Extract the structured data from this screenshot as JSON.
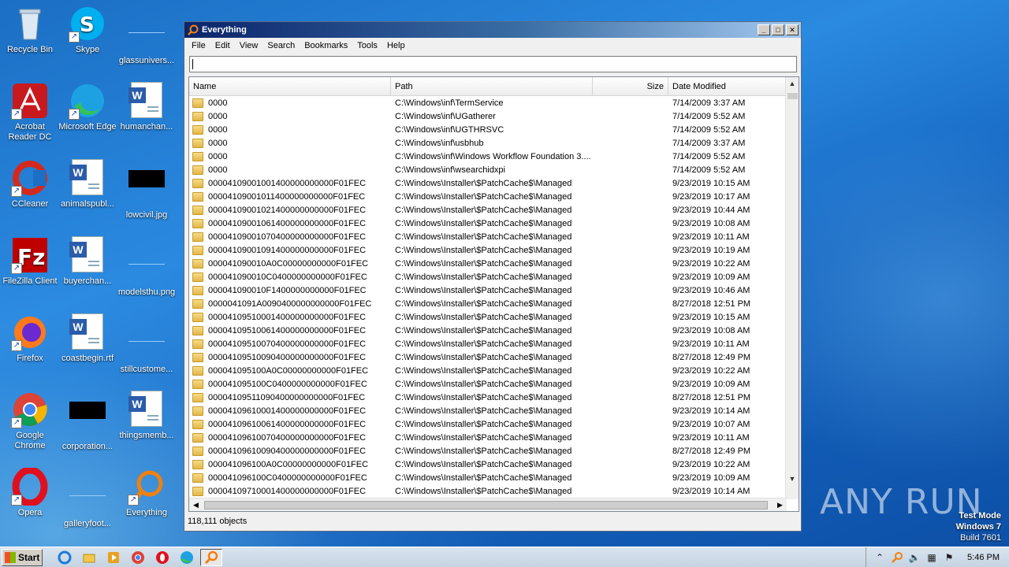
{
  "desktop": {
    "icons": [
      {
        "label": "Recycle Bin"
      },
      {
        "label": "Skype"
      },
      {
        "label": "glassunivers..."
      },
      {
        "label": "Acrobat Reader DC"
      },
      {
        "label": "Microsoft Edge"
      },
      {
        "label": "humanchan..."
      },
      {
        "label": "CCleaner"
      },
      {
        "label": "animalspubl..."
      },
      {
        "label": "lowcivil.jpg"
      },
      {
        "label": "FileZilla Client"
      },
      {
        "label": "buyerchan..."
      },
      {
        "label": "modelsthu.png"
      },
      {
        "label": "Firefox"
      },
      {
        "label": "coastbegin.rtf"
      },
      {
        "label": "stillcustome..."
      },
      {
        "label": "Google Chrome"
      },
      {
        "label": "corporation..."
      },
      {
        "label": "thingsmemb..."
      },
      {
        "label": "Opera"
      },
      {
        "label": "galleryfoot..."
      },
      {
        "label": "Everything"
      }
    ]
  },
  "window": {
    "title": "Everything",
    "controls": {
      "minimize": "_",
      "maximize": "□",
      "close": "✕"
    },
    "menu": [
      "File",
      "Edit",
      "View",
      "Search",
      "Bookmarks",
      "Tools",
      "Help"
    ],
    "search": {
      "value": "",
      "placeholder": ""
    },
    "columns": [
      "Name",
      "Path",
      "Size",
      "Date Modified"
    ],
    "rows": [
      {
        "name": "0000",
        "path": "C:\\Windows\\inf\\TermService",
        "size": "",
        "date": "7/14/2009 3:37 AM"
      },
      {
        "name": "0000",
        "path": "C:\\Windows\\inf\\UGatherer",
        "size": "",
        "date": "7/14/2009 5:52 AM"
      },
      {
        "name": "0000",
        "path": "C:\\Windows\\inf\\UGTHRSVC",
        "size": "",
        "date": "7/14/2009 5:52 AM"
      },
      {
        "name": "0000",
        "path": "C:\\Windows\\inf\\usbhub",
        "size": "",
        "date": "7/14/2009 3:37 AM"
      },
      {
        "name": "0000",
        "path": "C:\\Windows\\inf\\Windows Workflow Foundation 3....",
        "size": "",
        "date": "7/14/2009 5:52 AM"
      },
      {
        "name": "0000",
        "path": "C:\\Windows\\inf\\wsearchidxpi",
        "size": "",
        "date": "7/14/2009 5:52 AM"
      },
      {
        "name": "00004109001001400000000000F01FEC",
        "path": "C:\\Windows\\Installer\\$PatchCache$\\Managed",
        "size": "",
        "date": "9/23/2019 10:15 AM"
      },
      {
        "name": "00004109001011400000000000F01FEC",
        "path": "C:\\Windows\\Installer\\$PatchCache$\\Managed",
        "size": "",
        "date": "9/23/2019 10:17 AM"
      },
      {
        "name": "00004109001021400000000000F01FEC",
        "path": "C:\\Windows\\Installer\\$PatchCache$\\Managed",
        "size": "",
        "date": "9/23/2019 10:44 AM"
      },
      {
        "name": "00004109001061400000000000F01FEC",
        "path": "C:\\Windows\\Installer\\$PatchCache$\\Managed",
        "size": "",
        "date": "9/23/2019 10:08 AM"
      },
      {
        "name": "00004109001070400000000000F01FEC",
        "path": "C:\\Windows\\Installer\\$PatchCache$\\Managed",
        "size": "",
        "date": "9/23/2019 10:11 AM"
      },
      {
        "name": "00004109001091400000000000F01FEC",
        "path": "C:\\Windows\\Installer\\$PatchCache$\\Managed",
        "size": "",
        "date": "9/23/2019 10:19 AM"
      },
      {
        "name": "000041090010A0C00000000000F01FEC",
        "path": "C:\\Windows\\Installer\\$PatchCache$\\Managed",
        "size": "",
        "date": "9/23/2019 10:22 AM"
      },
      {
        "name": "000041090010C0400000000000F01FEC",
        "path": "C:\\Windows\\Installer\\$PatchCache$\\Managed",
        "size": "",
        "date": "9/23/2019 10:09 AM"
      },
      {
        "name": "000041090010F1400000000000F01FEC",
        "path": "C:\\Windows\\Installer\\$PatchCache$\\Managed",
        "size": "",
        "date": "9/23/2019 10:46 AM"
      },
      {
        "name": "0000041091A0090400000000000F01FEC",
        "path": "C:\\Windows\\Installer\\$PatchCache$\\Managed",
        "size": "",
        "date": "8/27/2018 12:51 PM"
      },
      {
        "name": "00004109510001400000000000F01FEC",
        "path": "C:\\Windows\\Installer\\$PatchCache$\\Managed",
        "size": "",
        "date": "9/23/2019 10:15 AM"
      },
      {
        "name": "00004109510061400000000000F01FEC",
        "path": "C:\\Windows\\Installer\\$PatchCache$\\Managed",
        "size": "",
        "date": "9/23/2019 10:08 AM"
      },
      {
        "name": "00004109510070400000000000F01FEC",
        "path": "C:\\Windows\\Installer\\$PatchCache$\\Managed",
        "size": "",
        "date": "9/23/2019 10:11 AM"
      },
      {
        "name": "00004109510090400000000000F01FEC",
        "path": "C:\\Windows\\Installer\\$PatchCache$\\Managed",
        "size": "",
        "date": "8/27/2018 12:49 PM"
      },
      {
        "name": "000041095100A0C00000000000F01FEC",
        "path": "C:\\Windows\\Installer\\$PatchCache$\\Managed",
        "size": "",
        "date": "9/23/2019 10:22 AM"
      },
      {
        "name": "000041095100C0400000000000F01FEC",
        "path": "C:\\Windows\\Installer\\$PatchCache$\\Managed",
        "size": "",
        "date": "9/23/2019 10:09 AM"
      },
      {
        "name": "00004109511090400000000000F01FEC",
        "path": "C:\\Windows\\Installer\\$PatchCache$\\Managed",
        "size": "",
        "date": "8/27/2018 12:51 PM"
      },
      {
        "name": "00004109610001400000000000F01FEC",
        "path": "C:\\Windows\\Installer\\$PatchCache$\\Managed",
        "size": "",
        "date": "9/23/2019 10:14 AM"
      },
      {
        "name": "00004109610061400000000000F01FEC",
        "path": "C:\\Windows\\Installer\\$PatchCache$\\Managed",
        "size": "",
        "date": "9/23/2019 10:07 AM"
      },
      {
        "name": "00004109610070400000000000F01FEC",
        "path": "C:\\Windows\\Installer\\$PatchCache$\\Managed",
        "size": "",
        "date": "9/23/2019 10:11 AM"
      },
      {
        "name": "00004109610090400000000000F01FEC",
        "path": "C:\\Windows\\Installer\\$PatchCache$\\Managed",
        "size": "",
        "date": "8/27/2018 12:49 PM"
      },
      {
        "name": "000041096100A0C00000000000F01FEC",
        "path": "C:\\Windows\\Installer\\$PatchCache$\\Managed",
        "size": "",
        "date": "9/23/2019 10:22 AM"
      },
      {
        "name": "000041096100C0400000000000F01FEC",
        "path": "C:\\Windows\\Installer\\$PatchCache$\\Managed",
        "size": "",
        "date": "9/23/2019 10:09 AM"
      },
      {
        "name": "00004109710001400000000000F01FEC",
        "path": "C:\\Windows\\Installer\\$PatchCache$\\Managed",
        "size": "",
        "date": "9/23/2019 10:14 AM"
      }
    ],
    "status": "118,111 objects"
  },
  "taskbar": {
    "start_label": "Start",
    "clock": "5:46 PM"
  },
  "watermark": {
    "line1": "Test Mode",
    "line2": "Windows 7",
    "line3": "Build 7601",
    "brand": "ANY RUN"
  },
  "colors": {
    "accent": "#0b246b",
    "desktop": "#1b6fc4"
  }
}
